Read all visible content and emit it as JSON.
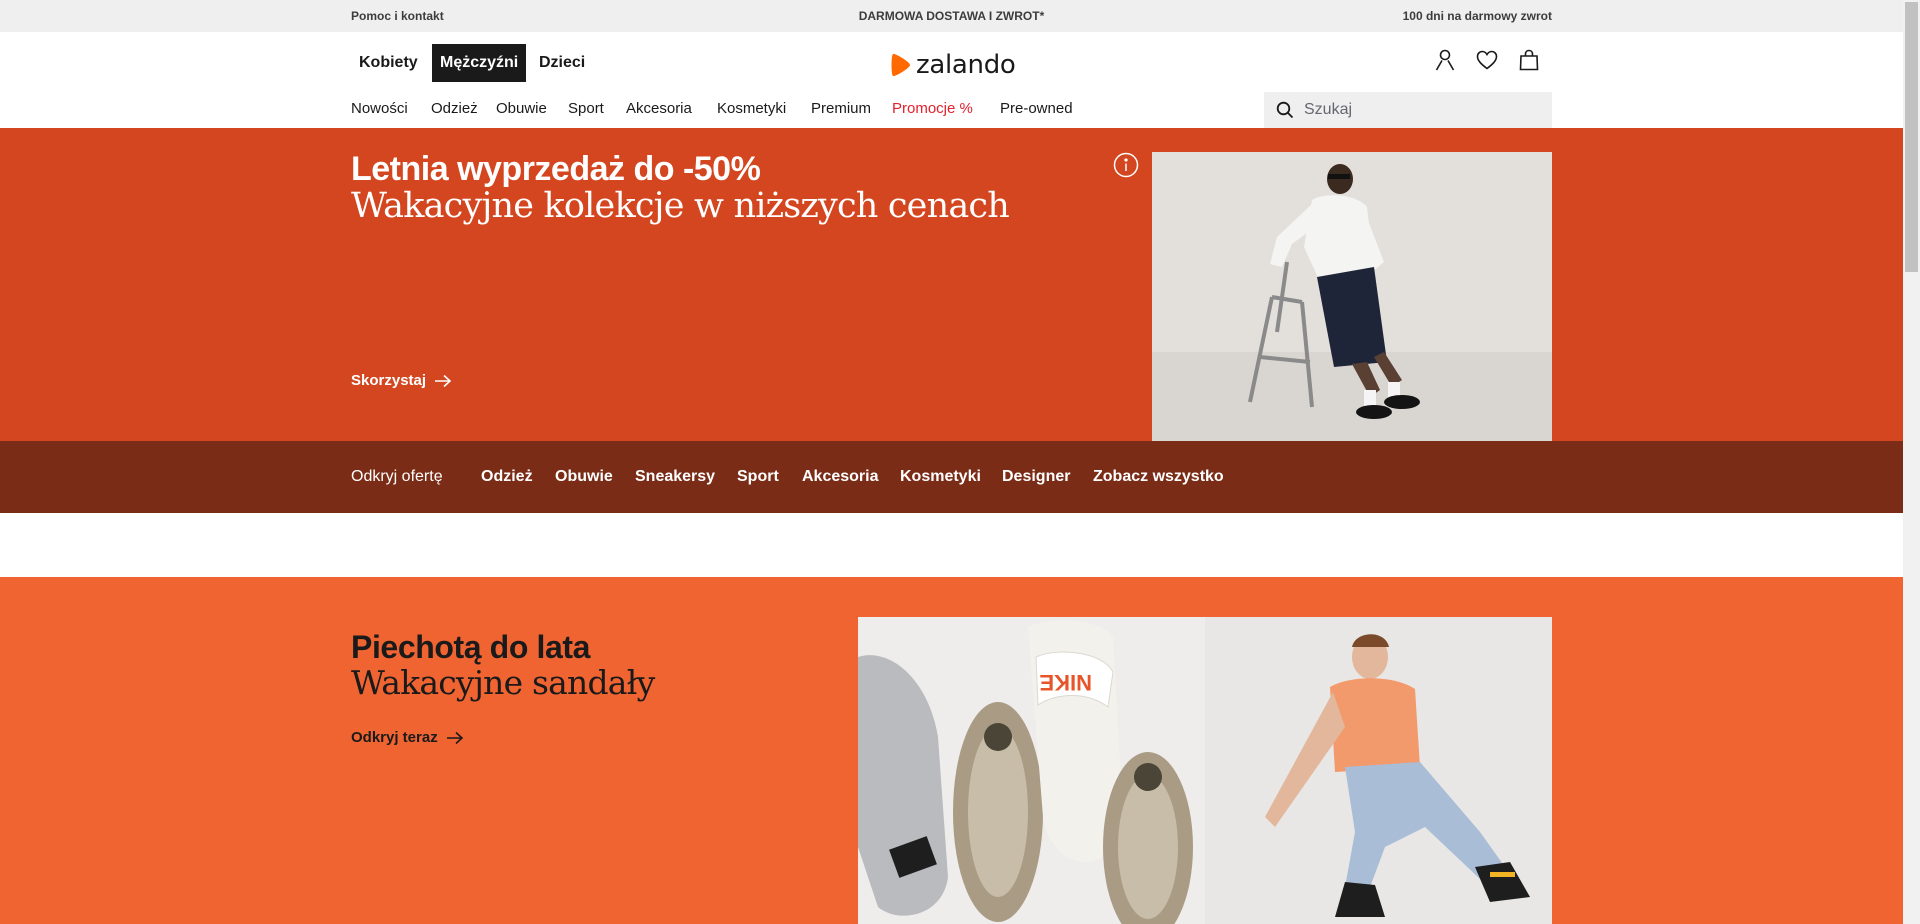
{
  "topbar": {
    "help": "Pomoc i kontakt",
    "shipping": "DARMOWA DOSTAWA I ZWROT*",
    "returns": "100 dni na darmowy zwrot"
  },
  "header": {
    "genders": [
      "Kobiety",
      "Mężczyźni",
      "Dzieci"
    ],
    "active_gender": "Mężczyźni",
    "logo": "zalando",
    "icons": [
      "user-icon",
      "heart-icon",
      "bag-icon"
    ],
    "categories": [
      "Nowości",
      "Odzież",
      "Obuwie",
      "Sport",
      "Akcesoria",
      "Kosmetyki",
      "Premium",
      "Promocje %",
      "Pre-owned"
    ],
    "search_placeholder": "Szukaj"
  },
  "hero": {
    "title": "Letnia wyprzedaż do -50%",
    "subtitle": "Wakacyjne kolekcje w niższych cenach",
    "cta": "Skorzystaj"
  },
  "discover": {
    "lead": "Odkryj ofertę",
    "links": [
      "Odzież",
      "Obuwie",
      "Sneakersy",
      "Sport",
      "Akcesoria",
      "Kosmetyki",
      "Designer",
      "Zobacz wszystko"
    ]
  },
  "promo2": {
    "title": "Piechotą do lata",
    "subtitle": "Wakacyjne sandały",
    "cta": "Odkryj teraz"
  },
  "colors": {
    "hero_bg": "#d3461f",
    "discover_bg": "#7a2c16",
    "promo2_bg": "#f06432",
    "promo_text": "#e5212d",
    "brand_orange": "#ff6900"
  }
}
